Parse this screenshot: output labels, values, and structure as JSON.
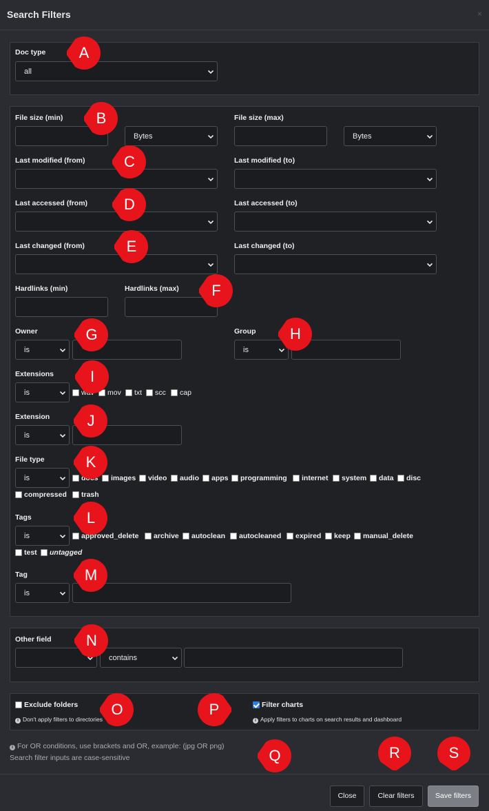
{
  "dialog": {
    "title": "Search Filters",
    "close_glyph": "×"
  },
  "doc_type": {
    "label": "Doc type",
    "value": "all"
  },
  "file_size": {
    "min_label": "File size (min)",
    "min_value": "",
    "min_unit": "Bytes",
    "max_label": "File size (max)",
    "max_value": "",
    "max_unit": "Bytes"
  },
  "last_modified": {
    "from_label": "Last modified (from)",
    "from_value": "",
    "to_label": "Last modified (to)",
    "to_value": ""
  },
  "last_accessed": {
    "from_label": "Last accessed (from)",
    "from_value": "",
    "to_label": "Last accessed (to)",
    "to_value": ""
  },
  "last_changed": {
    "from_label": "Last changed (from)",
    "from_value": "",
    "to_label": "Last changed (to)",
    "to_value": ""
  },
  "hardlinks": {
    "min_label": "Hardlinks (min)",
    "max_label": "Hardlinks (max)"
  },
  "owner": {
    "label": "Owner",
    "operator": "is",
    "value": ""
  },
  "group": {
    "label": "Group",
    "operator": "is",
    "value": ""
  },
  "extensions": {
    "label": "Extensions",
    "operator": "is",
    "options": [
      "wav",
      "mov",
      "txt",
      "scc",
      "cap"
    ]
  },
  "extension": {
    "label": "Extension",
    "operator": "is",
    "value": ""
  },
  "file_type": {
    "label": "File type",
    "operator": "is",
    "options": [
      "docs",
      "images",
      "video",
      "audio",
      "apps",
      "programming",
      "internet",
      "system",
      "data",
      "disc",
      "compressed",
      "trash"
    ]
  },
  "tags": {
    "label": "Tags",
    "operator": "is",
    "options": [
      "approved_delete",
      "archive",
      "autoclean",
      "autocleaned",
      "expired",
      "keep",
      "manual_delete",
      "test",
      "untagged"
    ]
  },
  "tag": {
    "label": "Tag",
    "operator": "is",
    "value": ""
  },
  "other_field": {
    "label": "Other field",
    "field": "",
    "operator": "contains",
    "value": ""
  },
  "exclude_folders": {
    "label": "Exclude folders",
    "checked": false,
    "hint": "Don't apply filters to directories"
  },
  "filter_charts": {
    "label": "Filter charts",
    "checked": true,
    "hint": "Apply filters to charts on search results and dashboard"
  },
  "notes": {
    "line1": "For OR conditions, use brackets and OR, example: (jpg OR png)",
    "line2": "Search filter inputs are case-sensitive"
  },
  "buttons": {
    "close": "Close",
    "clear": "Clear filters",
    "save": "Save filters"
  },
  "markers": [
    "A",
    "B",
    "C",
    "D",
    "E",
    "F",
    "G",
    "H",
    "I",
    "J",
    "K",
    "L",
    "M",
    "N",
    "O",
    "P",
    "Q",
    "R",
    "S"
  ],
  "colors": {
    "marker": "#e8141b",
    "background": "#2a2c31",
    "panel": "#202125",
    "checkbox_checked": "#2f7de1"
  }
}
